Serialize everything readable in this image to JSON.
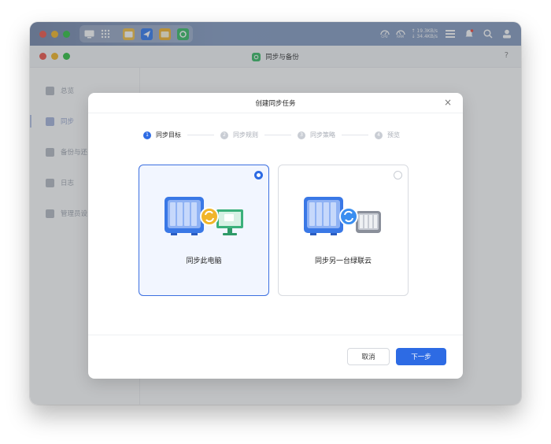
{
  "system_bar": {
    "cpu_label": "CPU",
    "ram_label": "RAM",
    "upload_speed": "↑ 19.3KB/s",
    "download_speed": "↓ 34.4KB/s"
  },
  "window": {
    "title": "同步与备份",
    "help_label": "?"
  },
  "sidebar": {
    "items": [
      {
        "label": "总览"
      },
      {
        "label": "同步"
      },
      {
        "label": "备份与还"
      },
      {
        "label": "日志"
      },
      {
        "label": "管理员设"
      }
    ]
  },
  "modal": {
    "title": "创建同步任务",
    "close_label": "×",
    "steps": [
      {
        "num": "1",
        "label": "同步目标"
      },
      {
        "num": "2",
        "label": "同步规则"
      },
      {
        "num": "3",
        "label": "同步策略"
      },
      {
        "num": "4",
        "label": "预览"
      }
    ],
    "options": [
      {
        "label": "同步此电脑",
        "selected": true
      },
      {
        "label": "同步另一台绿联云",
        "selected": false
      }
    ],
    "cancel_label": "取消",
    "next_label": "下一步"
  },
  "colors": {
    "accent": "#2d6be4",
    "sync_badge_orange": "#f1b52a",
    "sync_badge_blue": "#3a8ef0",
    "monitor_green": "#3bb07a"
  }
}
